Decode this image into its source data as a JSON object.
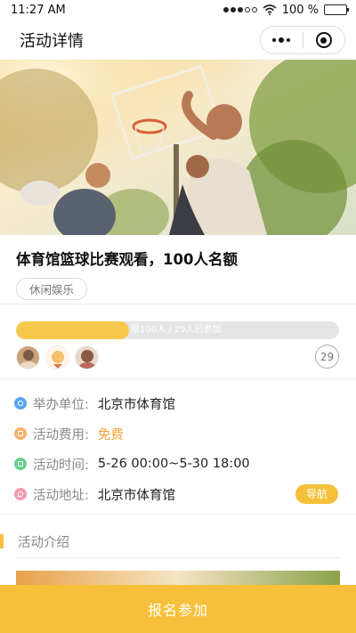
{
  "status_bar": {
    "time": "11:27 AM",
    "battery": "100 %"
  },
  "nav": {
    "title": "活动详情"
  },
  "event": {
    "title": "体育馆篮球比赛观看，100人名额",
    "tag": "休闲娱乐",
    "progress": {
      "joined": 29,
      "limit": 100,
      "fraction": 0.35,
      "text": "限100人 / 29人已参加"
    },
    "participant_count": "29"
  },
  "info": {
    "organizer": {
      "label": "举办单位:",
      "value": "北京市体育馆",
      "icon": "link-icon",
      "color": "#5aa6f0"
    },
    "fee": {
      "label": "活动费用:",
      "value": "免费",
      "icon": "money-icon",
      "color": "#f5b26a"
    },
    "time": {
      "label": "活动时间:",
      "value": "5-26 00:00~5-30 18:00",
      "icon": "clock-icon",
      "color": "#66d28c"
    },
    "address": {
      "label": "活动地址:",
      "value": "北京市体育馆",
      "icon": "location-icon",
      "color": "#f39ab0"
    },
    "nav_button": "导航"
  },
  "intro": {
    "title": "活动介绍"
  },
  "cta": {
    "label": "报名参加"
  },
  "colors": {
    "accent": "#f6c03a",
    "progress": "#f6c84c"
  }
}
